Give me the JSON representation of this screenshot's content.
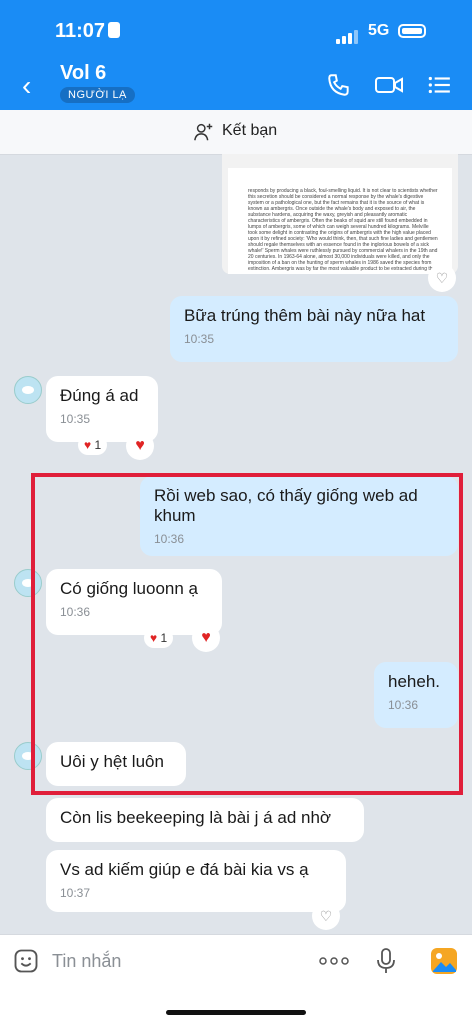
{
  "status_bar": {
    "time": "11:07",
    "network": "5G"
  },
  "header": {
    "title": "Vol 6",
    "tag": "NGƯỜI LẠ"
  },
  "add_friend": {
    "label": "Kết bạn"
  },
  "document_text": "responds by producing a black, foul-smelling liquid. It is not clear to scientists whether this secretion should be considered a normal response by the whale's digestive system or a pathological one, but the fact remains that it is the source of what is known as ambergris. Once outside the whale's body and exposed to air, the substance hardens, acquiring the waxy, greyish and pleasantly aromatic characteristics of ambergris. Often the beaks of squid are still found embedded in lumps of ambergris, some of which can weigh several hundred kilograms. Melville took some delight in contrasting the origins of ambergris with the high value placed upon it by refined society: 'Who would think, then, that such fine ladies and gentlemen should regale themselves with an essence found in the inglorious bowels of a sick whale!' Sperm whales were ruthlessly pursued by commercial whalers in the 19th and 20 centuries. In 1963-64 alone, almost 30,000 individuals were killed, and only the imposition of a ban on the hunting of sperm whales in 1986 saved the species from extinction. Ambergris was by far the most valuable product to be extracted during th",
  "messages": [
    {
      "text": "Bữa trúng thêm bài này nữa hat",
      "time": "10:35"
    },
    {
      "text": "Đúng á ad",
      "time": "10:35",
      "reaction_count": "1"
    },
    {
      "text": "Rồi web sao, có thấy giống web ad khum",
      "time": "10:36"
    },
    {
      "text": "Có giống luoonn ạ",
      "time": "10:36",
      "reaction_count": "1"
    },
    {
      "text": "heheh.",
      "time": "10:36"
    },
    {
      "text": "Uôi y hệt luôn"
    },
    {
      "text": "Còn lis beekeeping là bài j á ad nhờ"
    },
    {
      "text": "Vs ad kiếm giúp e đá bài kia vs ạ",
      "time": "10:37"
    }
  ],
  "input": {
    "placeholder": "Tin nhắn"
  },
  "colors": {
    "header": "#1a8cf5",
    "outgoing_bubble": "#d4ecff",
    "highlight": "#e01e3a"
  }
}
